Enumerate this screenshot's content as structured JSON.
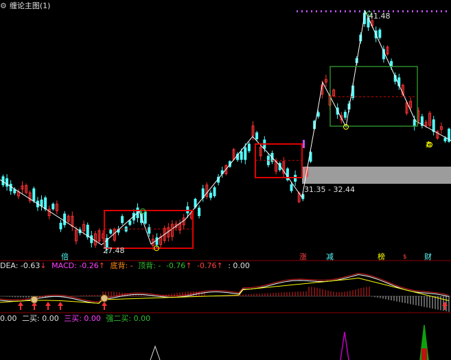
{
  "main_panel": {
    "title": "缠论主图(1)",
    "price_low_label": "27.48",
    "price_high_label": "41.48",
    "gap_label": "31.35 - 32.44",
    "signals": [
      "倍",
      "涨",
      "减",
      "榜",
      "财"
    ],
    "box_marker": "鑫"
  },
  "macd_panel": {
    "dea_label": "DEA: -0.63",
    "macd_label": "MACD: -0.26",
    "dibei_label": "底背: -",
    "dingbei_label": "顶背: -",
    "val1_label": "-0.76",
    "val2_label": "-0.76",
    "zero_label": ": 0.00"
  },
  "buy_panel": {
    "first_buy_value": "0.00",
    "second_buy_label": "二买: 0.00",
    "third_buy_label": "三买: 0.00",
    "strong_second_buy_label": "强二买: 0.00"
  },
  "colors": {
    "up": "#ff3232",
    "down": "#54fcfc",
    "zigzag": "#ffffff",
    "red_box": "#e00000",
    "green_box": "#2a8a2a",
    "gap_band": "#9c9c9c",
    "dif_line": "#ffffff",
    "dea_line": "#ffff00",
    "macd_red": "#e02020",
    "buy_magenta": "#c000c0",
    "buy_green": "#10a010"
  }
}
